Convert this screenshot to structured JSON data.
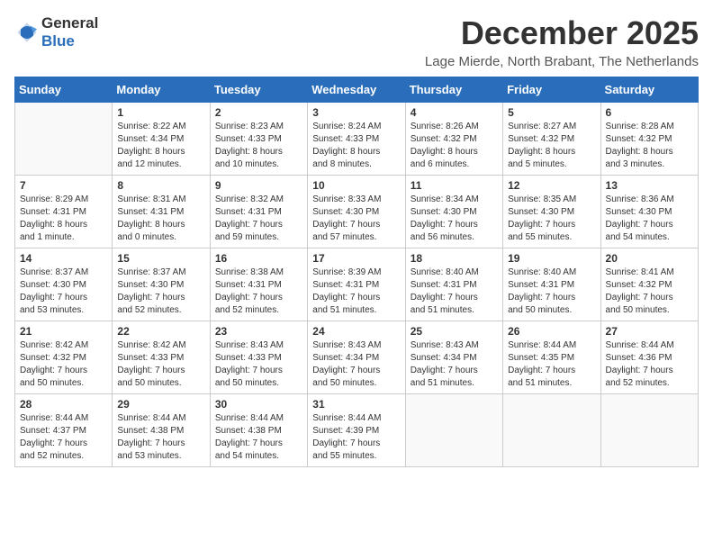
{
  "logo": {
    "text_general": "General",
    "text_blue": "Blue"
  },
  "title": "December 2025",
  "location": "Lage Mierde, North Brabant, The Netherlands",
  "weekdays": [
    "Sunday",
    "Monday",
    "Tuesday",
    "Wednesday",
    "Thursday",
    "Friday",
    "Saturday"
  ],
  "weeks": [
    [
      {
        "day": "",
        "info": ""
      },
      {
        "day": "1",
        "info": "Sunrise: 8:22 AM\nSunset: 4:34 PM\nDaylight: 8 hours\nand 12 minutes."
      },
      {
        "day": "2",
        "info": "Sunrise: 8:23 AM\nSunset: 4:33 PM\nDaylight: 8 hours\nand 10 minutes."
      },
      {
        "day": "3",
        "info": "Sunrise: 8:24 AM\nSunset: 4:33 PM\nDaylight: 8 hours\nand 8 minutes."
      },
      {
        "day": "4",
        "info": "Sunrise: 8:26 AM\nSunset: 4:32 PM\nDaylight: 8 hours\nand 6 minutes."
      },
      {
        "day": "5",
        "info": "Sunrise: 8:27 AM\nSunset: 4:32 PM\nDaylight: 8 hours\nand 5 minutes."
      },
      {
        "day": "6",
        "info": "Sunrise: 8:28 AM\nSunset: 4:32 PM\nDaylight: 8 hours\nand 3 minutes."
      }
    ],
    [
      {
        "day": "7",
        "info": "Sunrise: 8:29 AM\nSunset: 4:31 PM\nDaylight: 8 hours\nand 1 minute."
      },
      {
        "day": "8",
        "info": "Sunrise: 8:31 AM\nSunset: 4:31 PM\nDaylight: 8 hours\nand 0 minutes."
      },
      {
        "day": "9",
        "info": "Sunrise: 8:32 AM\nSunset: 4:31 PM\nDaylight: 7 hours\nand 59 minutes."
      },
      {
        "day": "10",
        "info": "Sunrise: 8:33 AM\nSunset: 4:30 PM\nDaylight: 7 hours\nand 57 minutes."
      },
      {
        "day": "11",
        "info": "Sunrise: 8:34 AM\nSunset: 4:30 PM\nDaylight: 7 hours\nand 56 minutes."
      },
      {
        "day": "12",
        "info": "Sunrise: 8:35 AM\nSunset: 4:30 PM\nDaylight: 7 hours\nand 55 minutes."
      },
      {
        "day": "13",
        "info": "Sunrise: 8:36 AM\nSunset: 4:30 PM\nDaylight: 7 hours\nand 54 minutes."
      }
    ],
    [
      {
        "day": "14",
        "info": "Sunrise: 8:37 AM\nSunset: 4:30 PM\nDaylight: 7 hours\nand 53 minutes."
      },
      {
        "day": "15",
        "info": "Sunrise: 8:37 AM\nSunset: 4:30 PM\nDaylight: 7 hours\nand 52 minutes."
      },
      {
        "day": "16",
        "info": "Sunrise: 8:38 AM\nSunset: 4:31 PM\nDaylight: 7 hours\nand 52 minutes."
      },
      {
        "day": "17",
        "info": "Sunrise: 8:39 AM\nSunset: 4:31 PM\nDaylight: 7 hours\nand 51 minutes."
      },
      {
        "day": "18",
        "info": "Sunrise: 8:40 AM\nSunset: 4:31 PM\nDaylight: 7 hours\nand 51 minutes."
      },
      {
        "day": "19",
        "info": "Sunrise: 8:40 AM\nSunset: 4:31 PM\nDaylight: 7 hours\nand 50 minutes."
      },
      {
        "day": "20",
        "info": "Sunrise: 8:41 AM\nSunset: 4:32 PM\nDaylight: 7 hours\nand 50 minutes."
      }
    ],
    [
      {
        "day": "21",
        "info": "Sunrise: 8:42 AM\nSunset: 4:32 PM\nDaylight: 7 hours\nand 50 minutes."
      },
      {
        "day": "22",
        "info": "Sunrise: 8:42 AM\nSunset: 4:33 PM\nDaylight: 7 hours\nand 50 minutes."
      },
      {
        "day": "23",
        "info": "Sunrise: 8:43 AM\nSunset: 4:33 PM\nDaylight: 7 hours\nand 50 minutes."
      },
      {
        "day": "24",
        "info": "Sunrise: 8:43 AM\nSunset: 4:34 PM\nDaylight: 7 hours\nand 50 minutes."
      },
      {
        "day": "25",
        "info": "Sunrise: 8:43 AM\nSunset: 4:34 PM\nDaylight: 7 hours\nand 51 minutes."
      },
      {
        "day": "26",
        "info": "Sunrise: 8:44 AM\nSunset: 4:35 PM\nDaylight: 7 hours\nand 51 minutes."
      },
      {
        "day": "27",
        "info": "Sunrise: 8:44 AM\nSunset: 4:36 PM\nDaylight: 7 hours\nand 52 minutes."
      }
    ],
    [
      {
        "day": "28",
        "info": "Sunrise: 8:44 AM\nSunset: 4:37 PM\nDaylight: 7 hours\nand 52 minutes."
      },
      {
        "day": "29",
        "info": "Sunrise: 8:44 AM\nSunset: 4:38 PM\nDaylight: 7 hours\nand 53 minutes."
      },
      {
        "day": "30",
        "info": "Sunrise: 8:44 AM\nSunset: 4:38 PM\nDaylight: 7 hours\nand 54 minutes."
      },
      {
        "day": "31",
        "info": "Sunrise: 8:44 AM\nSunset: 4:39 PM\nDaylight: 7 hours\nand 55 minutes."
      },
      {
        "day": "",
        "info": ""
      },
      {
        "day": "",
        "info": ""
      },
      {
        "day": "",
        "info": ""
      }
    ]
  ]
}
